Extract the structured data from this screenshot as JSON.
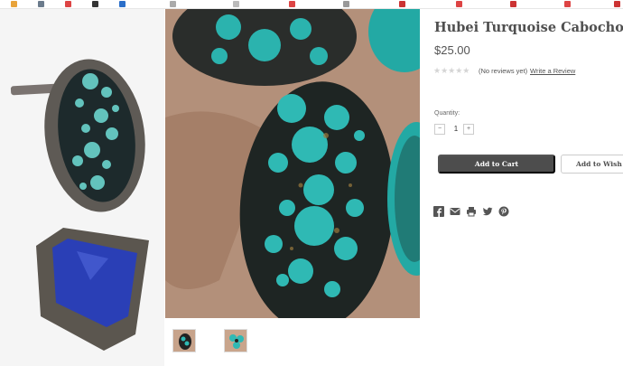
{
  "product": {
    "title": "Hubei Turquoise Cabochons",
    "price": "$25.00",
    "stars": "★★★★★",
    "reviews": "(No reviews yet)",
    "write_review": "Write a Review"
  },
  "quantity": {
    "label": "Quantity:",
    "value": "1",
    "decrement": "−",
    "increment": "+"
  },
  "actions": {
    "add_to_cart": "Add to Cart",
    "wishlist": "Add to Wish List"
  },
  "share_icons": [
    "facebook-icon",
    "email-icon",
    "print-icon",
    "twitter-icon",
    "pinterest-icon"
  ],
  "colors": {
    "turquoise": "#2fb9b4",
    "matrix": "#1b2324",
    "button": "#4d4d4d",
    "lapis": "#2a3fb6"
  }
}
